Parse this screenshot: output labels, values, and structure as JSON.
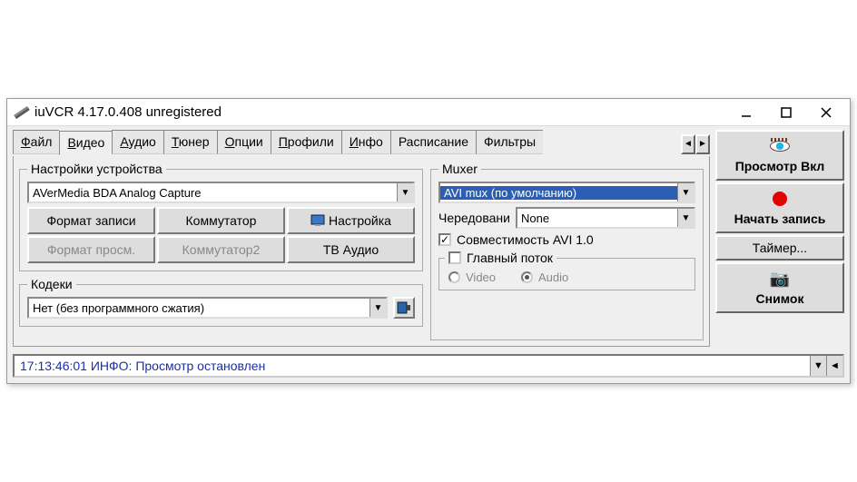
{
  "title": "iuVCR 4.17.0.408 unregistered",
  "tabs": [
    "Файл",
    "Видео",
    "Аудио",
    "Тюнер",
    "Опции",
    "Профили",
    "Инфо",
    "Расписание",
    "Фильтры"
  ],
  "tabs_accel": [
    "Ф",
    "В",
    "А",
    "Т",
    "О",
    "П",
    "И",
    "",
    ""
  ],
  "active_tab_index": 1,
  "device_settings": {
    "legend": "Настройки устройства",
    "device": "AVerMedia BDA Analog Capture",
    "btn_rec_format": "Формат записи",
    "btn_commutator": "Коммутатор",
    "btn_settings": "Настройка",
    "btn_view_format": "Формат просм.",
    "btn_commutator2": "Коммутатор2",
    "btn_tv_audio": "ТВ Аудио"
  },
  "codecs": {
    "legend": "Кодеки",
    "value": "Нет (без программного сжатия)"
  },
  "muxer": {
    "legend": "Muxer",
    "value": "AVI mux (по умолчанию)",
    "interleave_label": "Чередовани",
    "interleave_value": "None",
    "compat_label": "Совместимость AVI 1.0",
    "compat_checked": true,
    "main_stream_legend": "Главный поток",
    "radio_video": "Video",
    "radio_audio": "Audio",
    "radio_selected": "Audio"
  },
  "side": {
    "preview": "Просмотр Вкл",
    "record": "Начать запись",
    "timer": "Таймер...",
    "snapshot": "Снимок"
  },
  "status": "17:13:46:01 ИНФО: Просмотр остановлен"
}
